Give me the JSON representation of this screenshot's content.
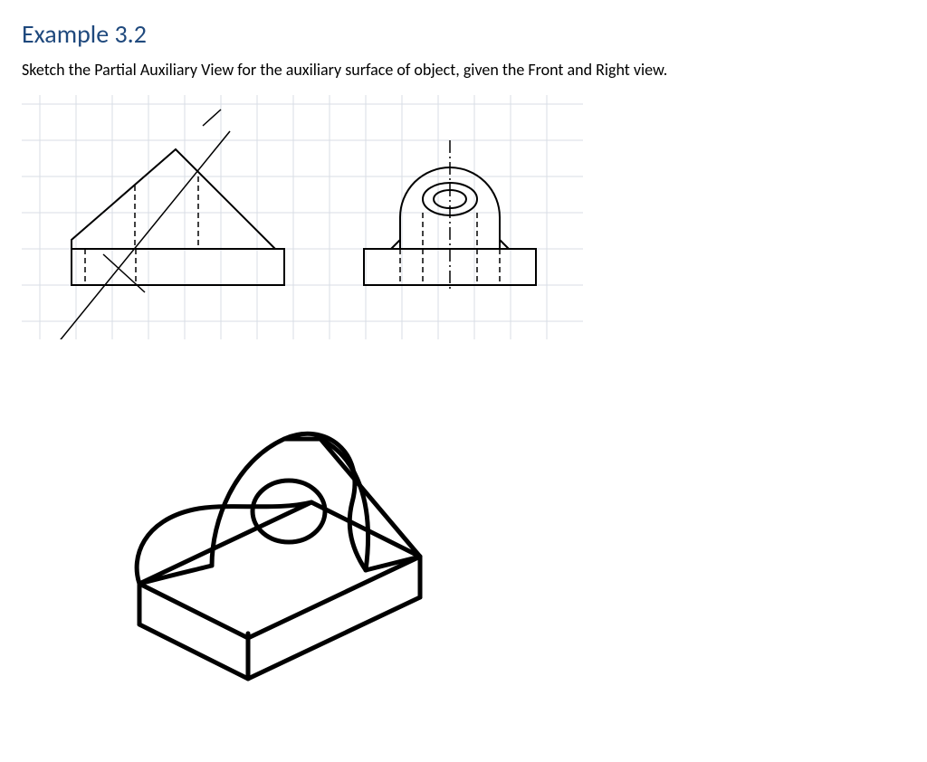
{
  "heading": "Example 3.2",
  "prompt": "Sketch the Partial Auxiliary View for the auxiliary surface of object, given the Front and Right view.",
  "accent_color": "#1f497d"
}
